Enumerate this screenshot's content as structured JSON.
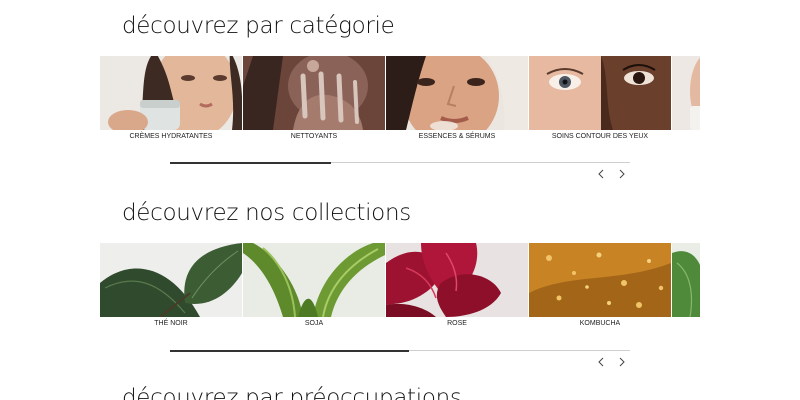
{
  "sections": [
    {
      "title": "découvrez par catégorie",
      "items": [
        {
          "label": "CRÈMES HYDRATANTES"
        },
        {
          "label": "NETTOYANTS"
        },
        {
          "label": "ESSENCES & SÉRUMS"
        },
        {
          "label": "SOINS CONTOUR DES YEUX"
        }
      ],
      "scroll_progress": 0.35
    },
    {
      "title": "découvrez nos collections",
      "items": [
        {
          "label": "THÉ NOIR"
        },
        {
          "label": "SOJA"
        },
        {
          "label": "ROSE"
        },
        {
          "label": "KOMBUCHA"
        }
      ],
      "scroll_progress": 0.52
    },
    {
      "title": "découvrez par préoccupations"
    }
  ],
  "icons": {
    "prev": "chevron-left-icon",
    "next": "chevron-right-icon"
  }
}
